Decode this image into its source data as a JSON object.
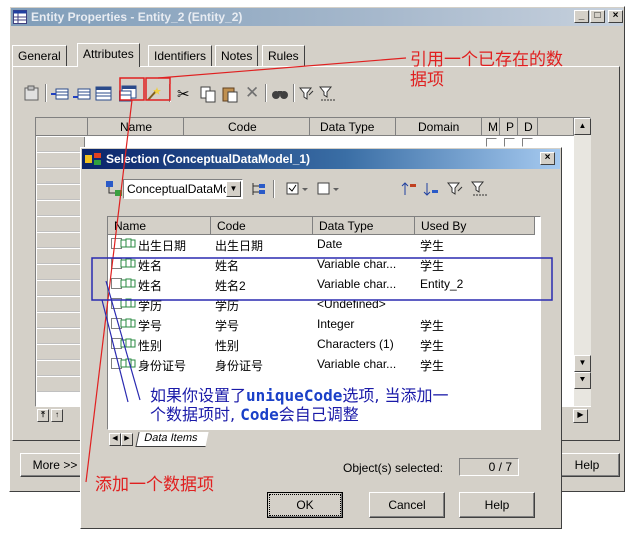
{
  "back_window": {
    "title": "Entity Properties - Entity_2 (Entity_2)",
    "tabs": [
      "General",
      "Attributes",
      "Identifiers",
      "Notes",
      "Rules"
    ],
    "grid_headers": [
      "Name",
      "Code",
      "Data Type",
      "Domain",
      "M",
      "P",
      "D"
    ],
    "more_button": "More >>",
    "help_button": "Help"
  },
  "dialog": {
    "title": "Selection (ConceptualDataModel_1)",
    "model_select": "ConceptualDataMo",
    "columns": [
      "Name",
      "Code",
      "Data Type",
      "Used By"
    ],
    "rows": [
      {
        "name": "出生日期",
        "code": "出生日期",
        "type": "Date",
        "used_by": "学生"
      },
      {
        "name": "姓名",
        "code": "姓名",
        "type": "Variable char...",
        "used_by": "学生"
      },
      {
        "name": "姓名",
        "code": "姓名2",
        "type": "Variable char...",
        "used_by": "Entity_2"
      },
      {
        "name": "学历",
        "code": "学历",
        "type": "<Undefined>",
        "used_by": ""
      },
      {
        "name": "学号",
        "code": "学号",
        "type": "Integer",
        "used_by": "学生"
      },
      {
        "name": "性别",
        "code": "性别",
        "type": "Characters (1)",
        "used_by": "学生"
      },
      {
        "name": "身份证号",
        "code": "身份证号",
        "type": "Variable char...",
        "used_by": "学生"
      }
    ],
    "sheet_tab": "Data Items",
    "objects_selected_label": "Object(s) selected:",
    "objects_selected_value": "0 / 7",
    "ok_button": "OK",
    "cancel_button": "Cancel",
    "help_button": "Help"
  },
  "annotations": {
    "reuse_line1": "引用一个已存在的数",
    "reuse_line2": "据项",
    "add_item": "添加一个数据项",
    "unique_line1_a": "如果你设置了",
    "unique_line1_b": "uniqueCode",
    "unique_line1_c": "选项, 当添加一",
    "unique_line2_a": "个数据项时, ",
    "unique_line2_b": "Code",
    "unique_line2_c": "会自己调整"
  },
  "colors": {
    "annotation_red": "#e02020",
    "annotation_blue": "#1a1aa8",
    "bold_code_blue": "#1a40c8",
    "highlight_box_blue": "#2a2ab0"
  }
}
